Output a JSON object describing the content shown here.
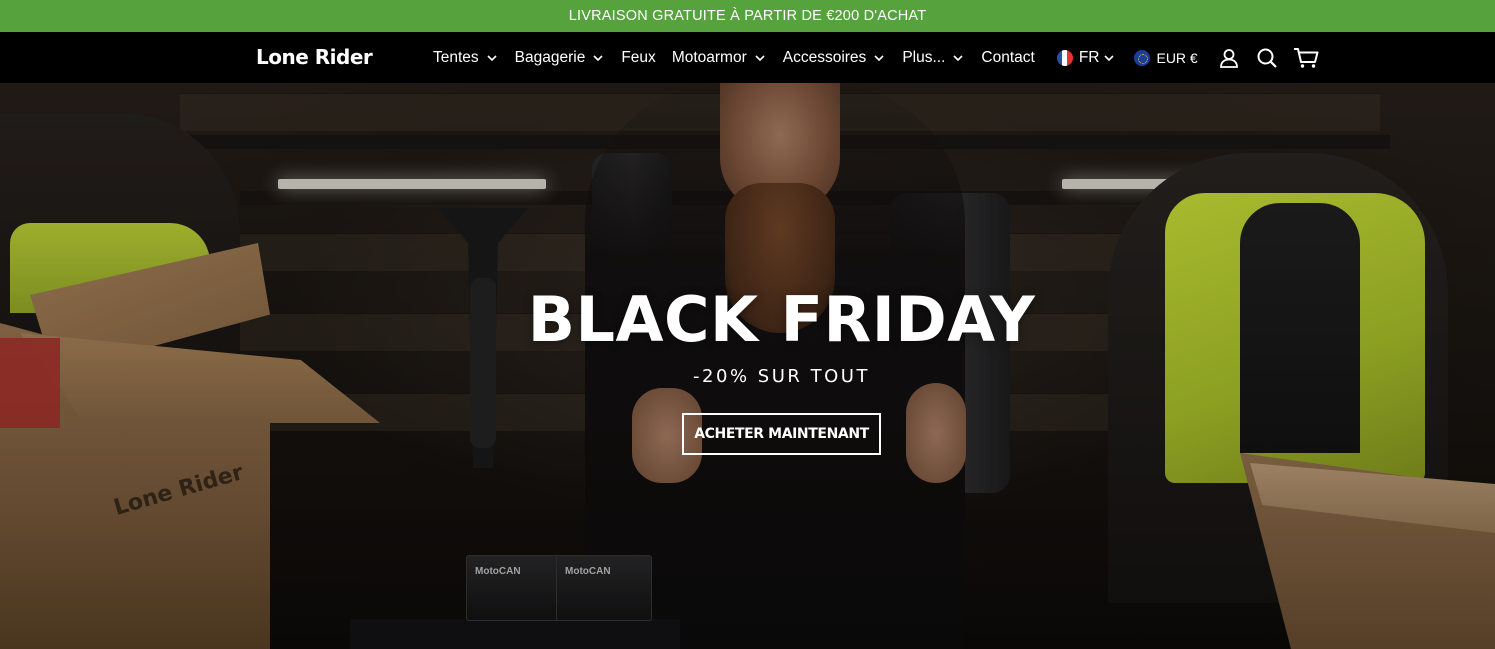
{
  "announcement": {
    "text": "LIVRAISON GRATUITE À PARTIR DE €200 D'ACHAT",
    "background": "#56a33e"
  },
  "header": {
    "logo": "Lone Rider",
    "nav": [
      {
        "label": "Tentes",
        "dropdown": true
      },
      {
        "label": "Bagagerie",
        "dropdown": true
      },
      {
        "label": "Feux",
        "dropdown": false
      },
      {
        "label": "Motoarmor",
        "dropdown": true
      },
      {
        "label": "Accessoires",
        "dropdown": true
      },
      {
        "label": "Plus...",
        "dropdown": true
      },
      {
        "label": "Contact",
        "dropdown": false
      }
    ],
    "language": {
      "label": "FR",
      "icon": "france-flag-icon"
    },
    "currency": {
      "label": "EUR €",
      "icon": "eu-flag-icon"
    },
    "icons": [
      "account-icon",
      "search-icon",
      "cart-icon"
    ]
  },
  "hero": {
    "title": "BLACK FRIDAY",
    "subtitle": "-20% SUR TOUT",
    "cta": "ACHETER MAINTENANT",
    "box_logo": "Lone Rider",
    "products": [
      "MotoCAN",
      "MotoCAN"
    ]
  }
}
